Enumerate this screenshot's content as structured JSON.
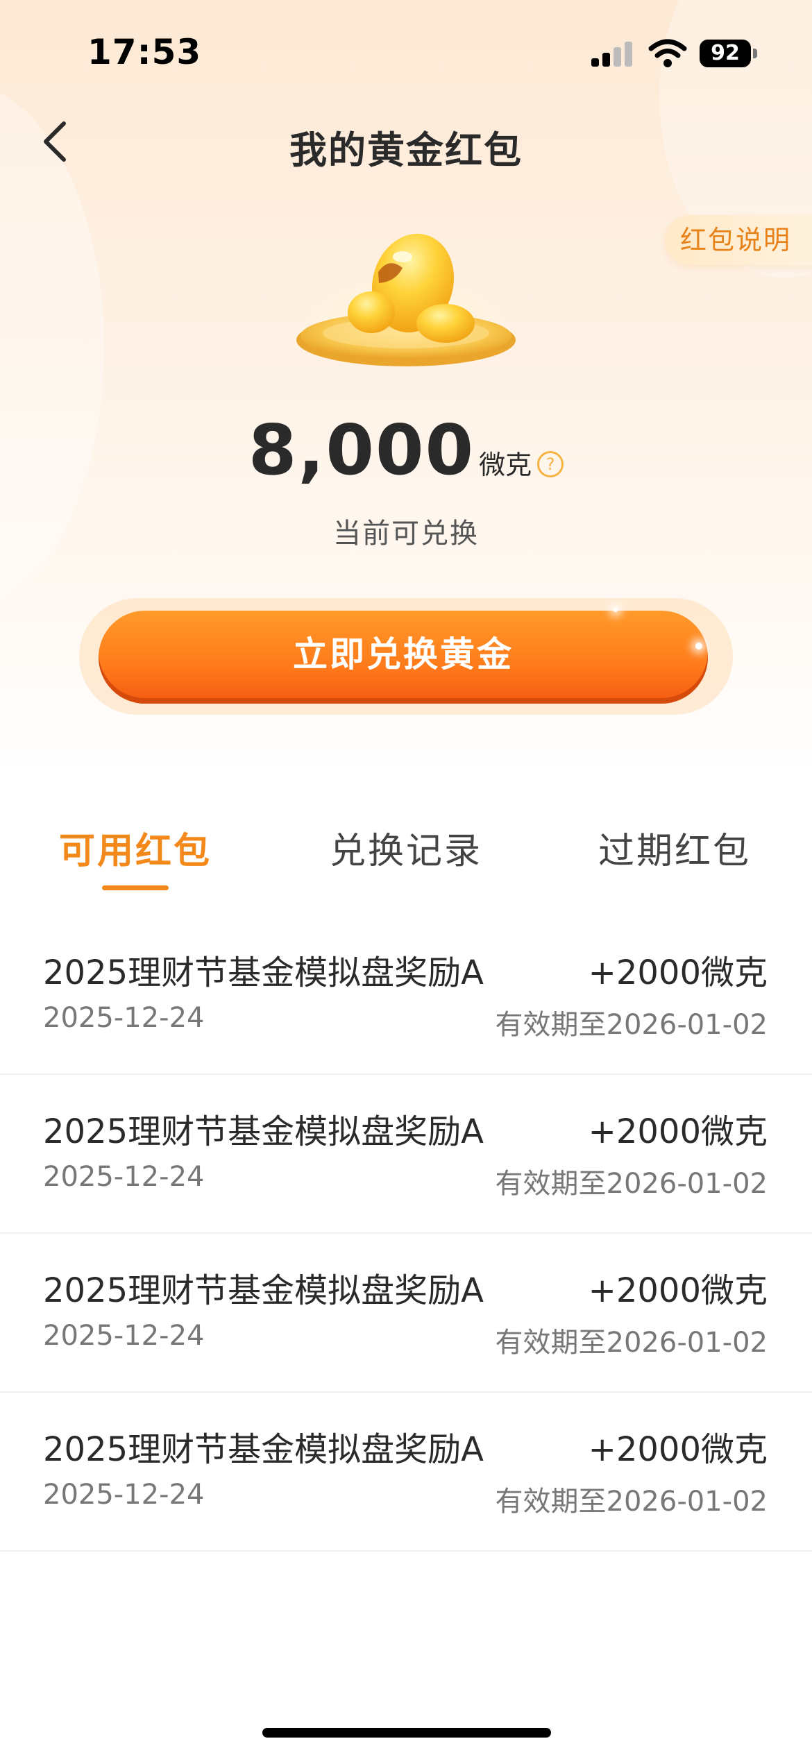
{
  "status_bar": {
    "time": "17:53",
    "battery": "92"
  },
  "header": {
    "title": "我的黄金红包",
    "rules_label": "红包说明"
  },
  "balance": {
    "amount": "8,000",
    "unit": "微克",
    "help_glyph": "?",
    "caption": "当前可兑换"
  },
  "redeem_button_label": "立即兑换黄金",
  "tabs": [
    {
      "label": "可用红包",
      "active": true
    },
    {
      "label": "兑换记录",
      "active": false
    },
    {
      "label": "过期红包",
      "active": false
    }
  ],
  "packets": [
    {
      "name": "2025理财节基金模拟盘奖励A",
      "amount": "+2000微克",
      "date": "2025-12-24",
      "expiry": "有效期至2026-01-02"
    },
    {
      "name": "2025理财节基金模拟盘奖励A",
      "amount": "+2000微克",
      "date": "2025-12-24",
      "expiry": "有效期至2026-01-02"
    },
    {
      "name": "2025理财节基金模拟盘奖励A",
      "amount": "+2000微克",
      "date": "2025-12-24",
      "expiry": "有效期至2026-01-02"
    },
    {
      "name": "2025理财节基金模拟盘奖励A",
      "amount": "+2000微克",
      "date": "2025-12-24",
      "expiry": "有效期至2026-01-02"
    }
  ],
  "icons": {
    "back": "chevron-left-icon",
    "signal": "cellular-signal-icon",
    "wifi": "wifi-icon",
    "battery": "battery-icon",
    "help": "question-circle-icon",
    "illustration": "gold-beans-icon"
  },
  "colors": {
    "accent": "#f2891a",
    "button": "#ff7a1a",
    "hero_bg": "#fde9d4"
  }
}
